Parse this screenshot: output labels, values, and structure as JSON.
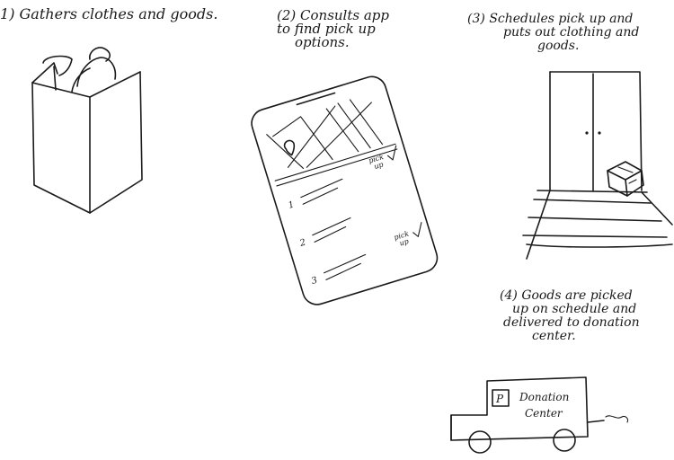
{
  "steps": [
    {
      "number": "1",
      "lines": [
        "Gathers clothes and goods."
      ]
    },
    {
      "number": "2",
      "lines": [
        "Consults app",
        "to find pick up",
        "options."
      ]
    },
    {
      "number": "3",
      "lines": [
        "Schedules pick up and",
        "puts out clothing and",
        "goods."
      ]
    },
    {
      "number": "4",
      "lines": [
        "Goods are picked",
        "up on schedule and",
        "delivered to donation",
        "center."
      ]
    }
  ],
  "phone": {
    "list_numbers": [
      "1",
      "2",
      "3"
    ],
    "pick_up_label": [
      "pick",
      "up"
    ]
  },
  "truck": {
    "logo": "P",
    "label_lines": [
      "Donation",
      "Center"
    ]
  }
}
